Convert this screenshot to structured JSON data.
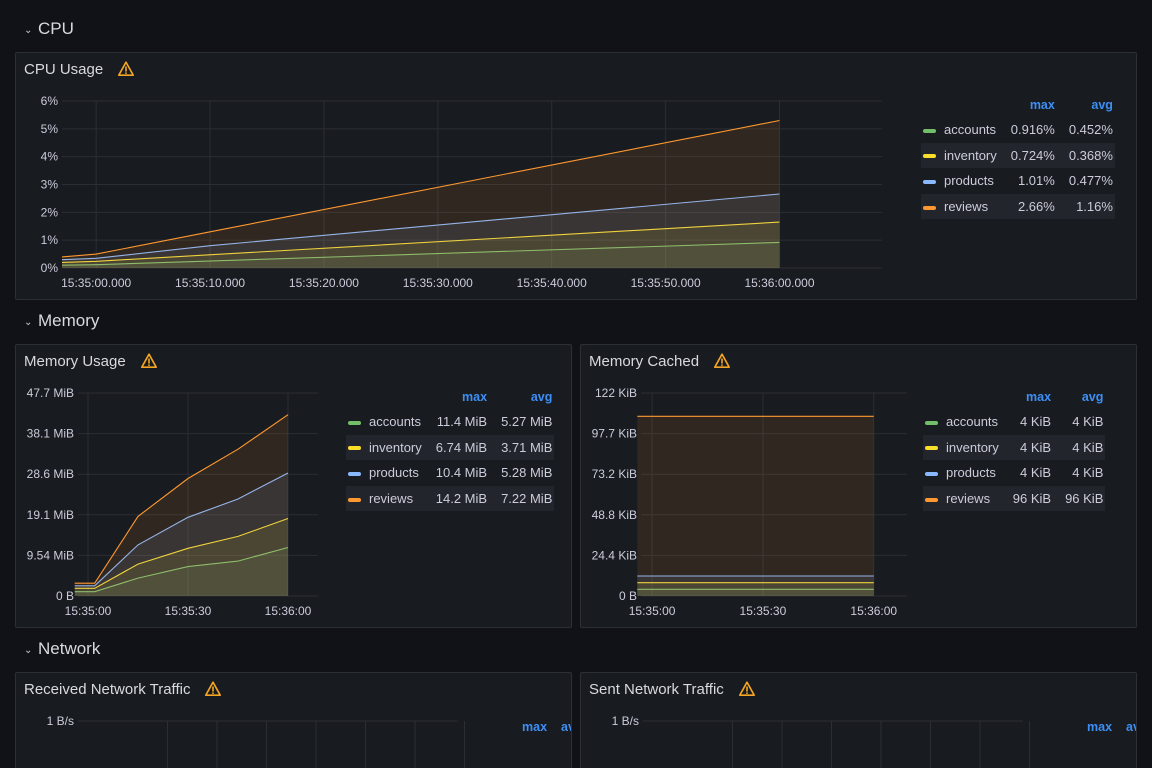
{
  "rows": {
    "cpu": "CPU",
    "memory": "Memory",
    "network": "Network"
  },
  "icons": {
    "collapse": "chevron-down-icon",
    "warning": "warning-icon"
  },
  "colors": {
    "accounts": "#73bf69",
    "inventory": "#fade2a",
    "products": "#8ab8ff",
    "reviews": "#ff9830",
    "legend_header": "#3d8ff5",
    "warning": "#f5a623"
  },
  "panels": {
    "cpu_usage": {
      "title": "CPU Usage",
      "legend": {
        "headers": [
          "max",
          "avg"
        ],
        "rows": [
          {
            "name": "accounts",
            "max": "0.916%",
            "avg": "0.452%"
          },
          {
            "name": "inventory",
            "max": "0.724%",
            "avg": "0.368%"
          },
          {
            "name": "products",
            "max": "1.01%",
            "avg": "0.477%"
          },
          {
            "name": "reviews",
            "max": "2.66%",
            "avg": "1.16%"
          }
        ]
      }
    },
    "memory_usage": {
      "title": "Memory Usage",
      "legend": {
        "headers": [
          "max",
          "avg"
        ],
        "rows": [
          {
            "name": "accounts",
            "max": "11.4 MiB",
            "avg": "5.27 MiB"
          },
          {
            "name": "inventory",
            "max": "6.74 MiB",
            "avg": "3.71 MiB"
          },
          {
            "name": "products",
            "max": "10.4 MiB",
            "avg": "5.28 MiB"
          },
          {
            "name": "reviews",
            "max": "14.2 MiB",
            "avg": "7.22 MiB"
          }
        ]
      }
    },
    "memory_cached": {
      "title": "Memory Cached",
      "legend": {
        "headers": [
          "max",
          "avg"
        ],
        "rows": [
          {
            "name": "accounts",
            "max": "4 KiB",
            "avg": "4 KiB"
          },
          {
            "name": "inventory",
            "max": "4 KiB",
            "avg": "4 KiB"
          },
          {
            "name": "products",
            "max": "4 KiB",
            "avg": "4 KiB"
          },
          {
            "name": "reviews",
            "max": "96 KiB",
            "avg": "96 KiB"
          }
        ]
      }
    },
    "received_network": {
      "title": "Received Network Traffic",
      "legend": {
        "headers": [
          "max",
          "avg"
        ]
      }
    },
    "sent_network": {
      "title": "Sent Network Traffic",
      "legend": {
        "headers": [
          "max",
          "avg"
        ]
      }
    }
  },
  "chart_data": [
    {
      "id": "cpu",
      "type": "area",
      "title": "CPU Usage",
      "x": [
        "15:34:58",
        "15:35:00",
        "15:35:10",
        "15:35:20",
        "15:35:30",
        "15:35:40",
        "15:35:50",
        "15:36:00"
      ],
      "xticks": [
        "15:35:00.000",
        "15:35:10.000",
        "15:35:20.000",
        "15:35:30.000",
        "15:35:40.000",
        "15:35:50.000",
        "15:36:00.000"
      ],
      "yticks": [
        "0%",
        "1%",
        "2%",
        "3%",
        "4%",
        "5%",
        "6%"
      ],
      "ylim": [
        0,
        6
      ],
      "xlim": [
        "15:34:57.000",
        "15:36:09.000"
      ],
      "series": [
        {
          "name": "accounts",
          "x": [
            "15:34:57.000",
            "15:35:00.000",
            "15:36:00.000"
          ],
          "y": [
            0.1,
            0.12,
            0.92
          ]
        },
        {
          "name": "inventory",
          "x": [
            "15:34:57.000",
            "15:35:00.000",
            "15:36:00.000"
          ],
          "y": [
            0.2,
            0.24,
            1.65
          ]
        },
        {
          "name": "products",
          "x": [
            "15:34:57.000",
            "15:35:00.000",
            "15:35:10.000",
            "15:36:00.000"
          ],
          "y": [
            0.3,
            0.35,
            0.8,
            2.66
          ]
        },
        {
          "name": "reviews",
          "x": [
            "15:34:57.000",
            "15:35:00.000",
            "15:35:10.000",
            "15:36:00.000"
          ],
          "y": [
            0.4,
            0.5,
            1.3,
            5.3
          ]
        }
      ]
    },
    {
      "id": "memory_usage",
      "type": "area",
      "title": "Memory Usage",
      "xticks": [
        "15:35:00",
        "15:35:30",
        "15:36:00"
      ],
      "yticks": [
        "0 B",
        "9.54 MiB",
        "19.1 MiB",
        "28.6 MiB",
        "38.1 MiB",
        "47.7 MiB"
      ],
      "ylim": [
        0,
        47.7
      ],
      "xlim": [
        "15:34:57",
        "15:36:09"
      ],
      "series": [
        {
          "name": "accounts",
          "x": [
            "15:34:56",
            "15:35:02",
            "15:35:15",
            "15:35:30",
            "15:35:45",
            "15:36:00"
          ],
          "y": [
            1.0,
            1.0,
            4.2,
            6.9,
            8.2,
            11.4
          ]
        },
        {
          "name": "inventory",
          "x": [
            "15:34:56",
            "15:35:02",
            "15:35:15",
            "15:35:30",
            "15:35:45",
            "15:36:00"
          ],
          "y": [
            1.8,
            1.8,
            7.5,
            11.2,
            14.0,
            18.2
          ]
        },
        {
          "name": "products",
          "x": [
            "15:34:56",
            "15:35:02",
            "15:35:15",
            "15:35:30",
            "15:35:45",
            "15:36:00"
          ],
          "y": [
            2.4,
            2.4,
            12.0,
            18.5,
            22.8,
            28.9
          ]
        },
        {
          "name": "reviews",
          "x": [
            "15:34:56",
            "15:35:02",
            "15:35:15",
            "15:35:30",
            "15:35:45",
            "15:36:00"
          ],
          "y": [
            3.0,
            3.0,
            18.7,
            27.6,
            34.5,
            42.6
          ]
        }
      ]
    },
    {
      "id": "memory_cached",
      "type": "area",
      "title": "Memory Cached",
      "xticks": [
        "15:35:00",
        "15:35:30",
        "15:36:00"
      ],
      "yticks": [
        "0 B",
        "24.4 KiB",
        "48.8 KiB",
        "73.2 KiB",
        "97.7 KiB",
        "122 KiB"
      ],
      "ylim": [
        0,
        122
      ],
      "xlim": [
        "15:34:57",
        "15:36:09"
      ],
      "series": [
        {
          "name": "accounts",
          "x": [
            "15:34:56",
            "15:36:00"
          ],
          "y": [
            4,
            4
          ]
        },
        {
          "name": "inventory",
          "x": [
            "15:34:56",
            "15:36:00"
          ],
          "y": [
            8,
            8
          ]
        },
        {
          "name": "products",
          "x": [
            "15:34:56",
            "15:36:00"
          ],
          "y": [
            12,
            12
          ]
        },
        {
          "name": "reviews",
          "x": [
            "15:34:56",
            "15:36:00"
          ],
          "y": [
            108,
            108
          ]
        }
      ]
    },
    {
      "id": "received_network",
      "type": "area",
      "title": "Received Network Traffic",
      "yticks": [
        "1 B/s"
      ],
      "series": []
    },
    {
      "id": "sent_network",
      "type": "area",
      "title": "Sent Network Traffic",
      "yticks": [
        "1 B/s"
      ],
      "series": []
    }
  ]
}
